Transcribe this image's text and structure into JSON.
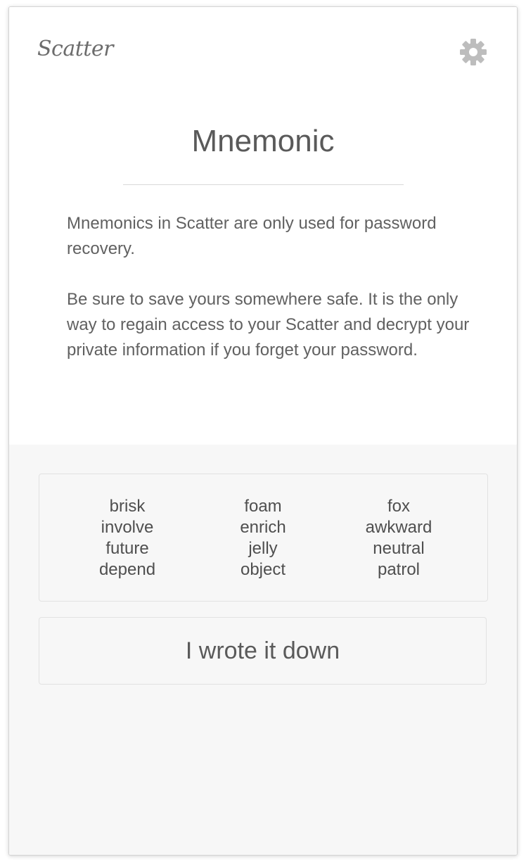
{
  "header": {
    "logo_text": "Scatter",
    "settings_icon": "gear-icon"
  },
  "main": {
    "title": "Mnemonic",
    "description": [
      "Mnemonics in Scatter are only used for password recovery.",
      "Be sure to save yours somewhere safe. It is the only way to regain access to your Scatter and decrypt your private information if you forget your password."
    ]
  },
  "mnemonic": {
    "columns": [
      [
        "brisk",
        "involve",
        "future",
        "depend"
      ],
      [
        "foam",
        "enrich",
        "jelly",
        "object"
      ],
      [
        "fox",
        "awkward",
        "neutral",
        "patrol"
      ]
    ]
  },
  "actions": {
    "confirm_label": "I wrote it down"
  },
  "colors": {
    "text": "#555555",
    "bottom_background": "#f7f7f7",
    "border": "#e2e2e2",
    "icon": "#bdbdbd"
  }
}
